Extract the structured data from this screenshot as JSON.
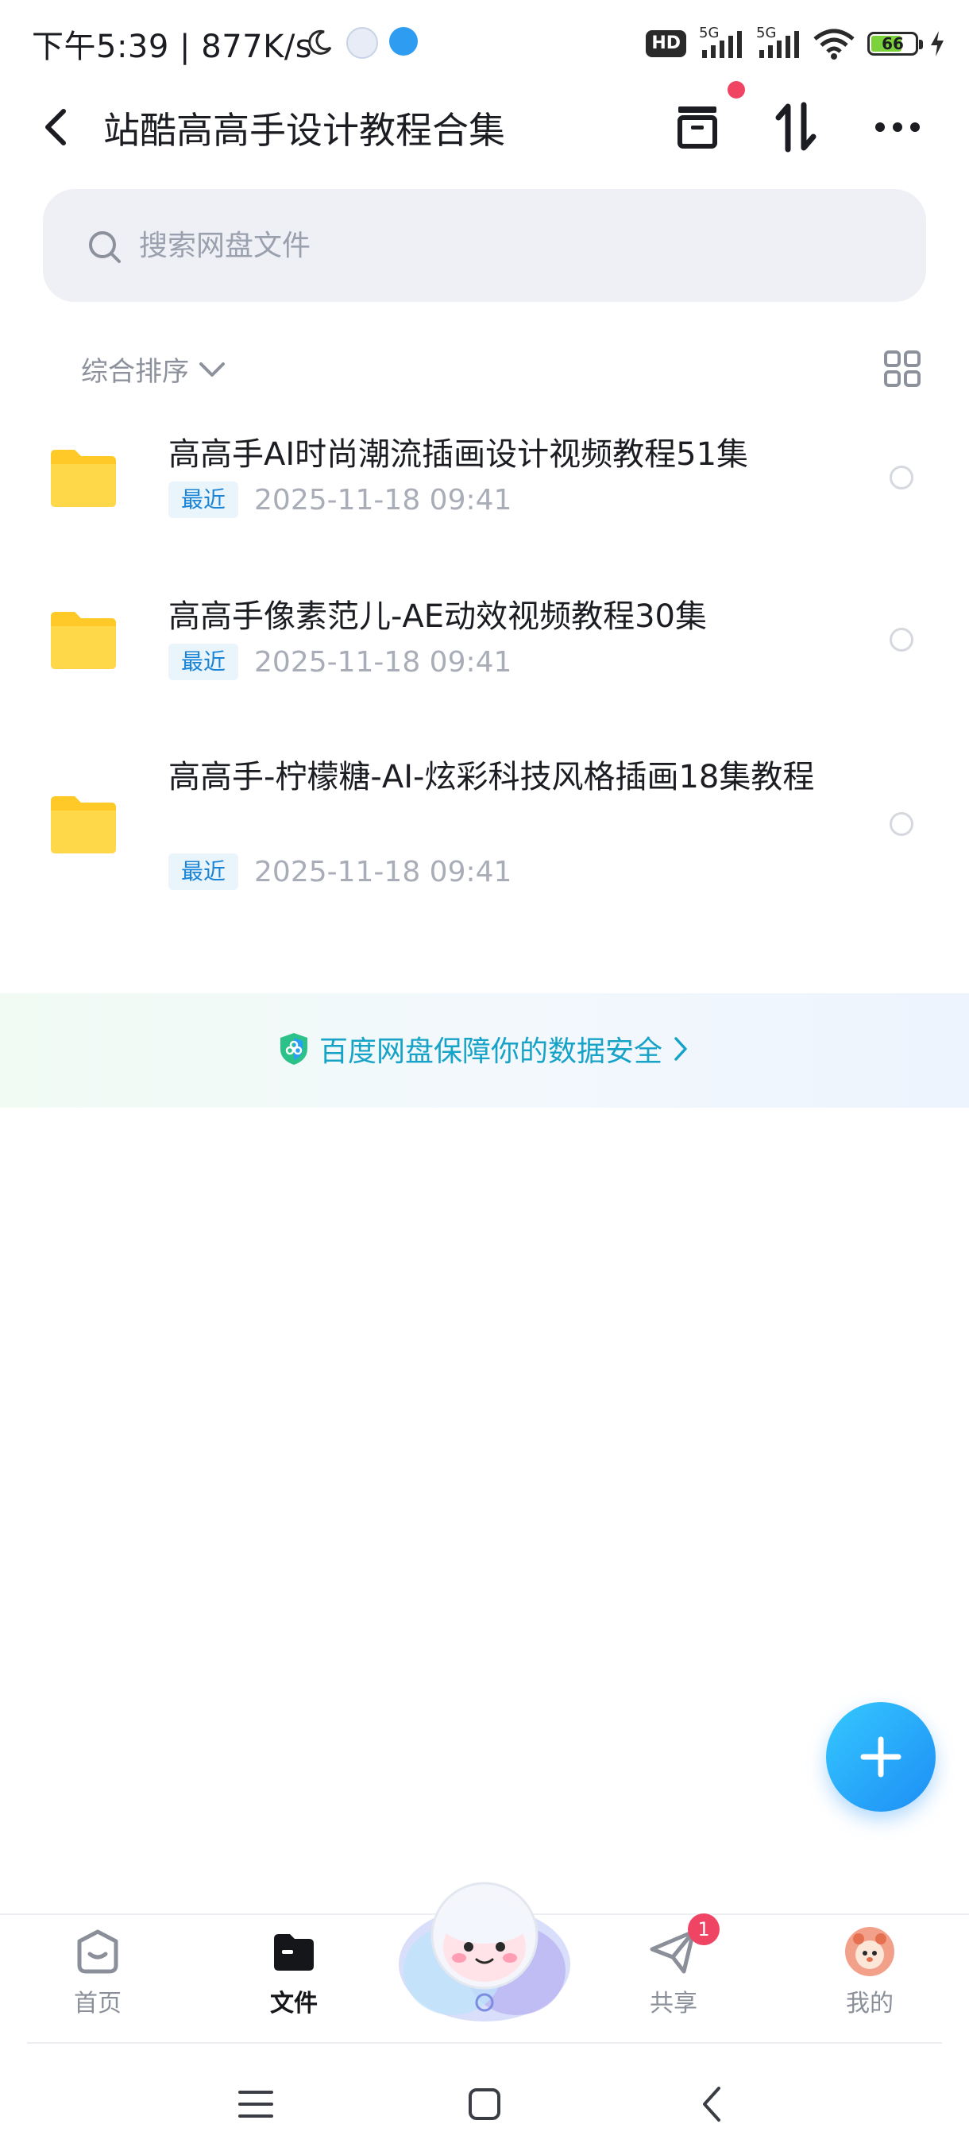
{
  "status_bar": {
    "time": "下午5:39",
    "speed": "877K/s",
    "hd": "HD",
    "net1": "5G",
    "net2": "5G",
    "battery": "66"
  },
  "header": {
    "title": "站酷高高手设计教程合集",
    "icons": [
      "back-icon",
      "archive-icon",
      "sort-updown-icon",
      "more-icon"
    ]
  },
  "search": {
    "placeholder": "搜索网盘文件"
  },
  "sort": {
    "label": "综合排序"
  },
  "files": [
    {
      "name": "高高手AI时尚潮流插画设计视频教程51集",
      "tag": "最近",
      "date": "2025-11-18  09:41"
    },
    {
      "name": "高高手像素范儿-AE动效视频教程30集",
      "tag": "最近",
      "date": "2025-11-18  09:41"
    },
    {
      "name": "高高手-柠檬糖-AI-炫彩科技风格插画18集教程",
      "tag": "最近",
      "date": "2025-11-18  09:41"
    }
  ],
  "banner": {
    "text": "百度网盘保障你的数据安全"
  },
  "tabs": [
    {
      "label": "首页",
      "active": false
    },
    {
      "label": "文件",
      "active": true
    },
    {
      "label": "共享",
      "active": false,
      "badge": "1"
    },
    {
      "label": "我的",
      "active": false
    }
  ],
  "colors": {
    "accent": "#1d8ef5",
    "badge": "#f04464",
    "folder": "#ffc928",
    "banner_text": "#17a3c8"
  }
}
